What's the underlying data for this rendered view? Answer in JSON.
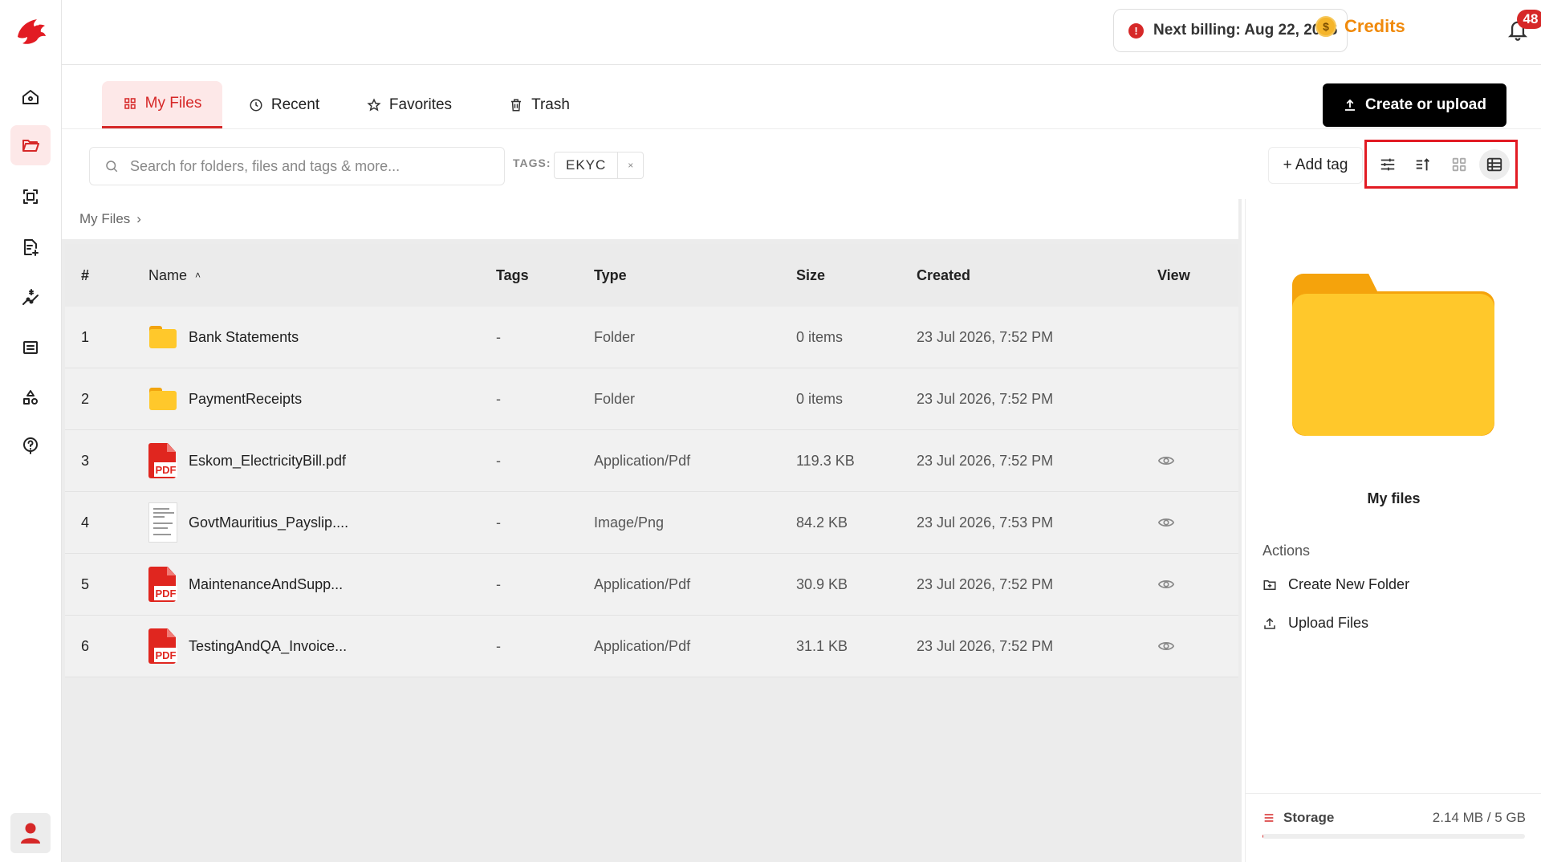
{
  "header": {
    "billing_text": "Next billing: Aug 22, 2026",
    "billing_icon": "!",
    "credits_label": "Credits",
    "coin_symbol": "$",
    "notification_count": "48"
  },
  "tabs": [
    {
      "label": "My Files",
      "icon": "grid-icon",
      "active": true
    },
    {
      "label": "Recent",
      "icon": "clock-icon",
      "active": false
    },
    {
      "label": "Favorites",
      "icon": "star-icon",
      "active": false
    },
    {
      "label": "Trash",
      "icon": "trash-icon",
      "active": false
    }
  ],
  "create_button": "Create or upload",
  "search": {
    "placeholder": "Search for folders, files and tags & more..."
  },
  "tags_label": "TAGS:",
  "tag_chips": [
    {
      "label": "EKYC",
      "remove": "×"
    }
  ],
  "add_tag": "+ Add tag",
  "breadcrumb": {
    "root": "My Files",
    "separator": "›"
  },
  "table": {
    "columns": {
      "num": "#",
      "name": "Name",
      "name_sort": "˄",
      "tags": "Tags",
      "type": "Type",
      "size": "Size",
      "created": "Created",
      "view": "View"
    },
    "rows": [
      {
        "num": "1",
        "name": "Bank Statements",
        "kind": "folder",
        "tags": "-",
        "type": "Folder",
        "size": "0 items",
        "created": "23 Jul 2026, 7:52 PM",
        "viewable": false
      },
      {
        "num": "2",
        "name": "PaymentReceipts",
        "kind": "folder",
        "tags": "-",
        "type": "Folder",
        "size": "0 items",
        "created": "23 Jul 2026, 7:52 PM",
        "viewable": false
      },
      {
        "num": "3",
        "name": "Eskom_ElectricityBill.pdf",
        "kind": "pdf",
        "tags": "-",
        "type": "Application/Pdf",
        "size": "119.3 KB",
        "created": "23 Jul 2026, 7:52 PM",
        "viewable": true
      },
      {
        "num": "4",
        "name": "GovtMauritius_Payslip....",
        "kind": "image",
        "tags": "-",
        "type": "Image/Png",
        "size": "84.2 KB",
        "created": "23 Jul 2026, 7:53 PM",
        "viewable": true
      },
      {
        "num": "5",
        "name": "MaintenanceAndSupp...",
        "kind": "pdf",
        "tags": "-",
        "type": "Application/Pdf",
        "size": "30.9 KB",
        "created": "23 Jul 2026, 7:52 PM",
        "viewable": true
      },
      {
        "num": "6",
        "name": "TestingAndQA_Invoice...",
        "kind": "pdf",
        "tags": "-",
        "type": "Application/Pdf",
        "size": "31.1 KB",
        "created": "23 Jul 2026, 7:52 PM",
        "viewable": true
      }
    ],
    "pdf_label": "PDF"
  },
  "right_panel": {
    "title": "My files",
    "actions_label": "Actions",
    "actions": [
      "Create New Folder",
      "Upload Files"
    ],
    "storage_label": "Storage",
    "storage_value": "2.14 MB / 5 GB",
    "storage_used_fraction": 0.0004
  },
  "colors": {
    "accent": "#d62828",
    "folder": "#ffc82b",
    "credits": "#f08a0c"
  }
}
